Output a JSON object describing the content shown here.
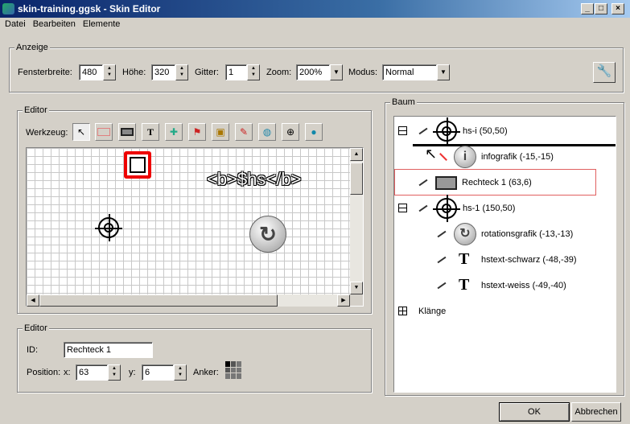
{
  "window": {
    "title": "skin-training.ggsk - Skin Editor",
    "controls": [
      "_",
      "□",
      "×"
    ]
  },
  "menu": [
    "Datei",
    "Bearbeiten",
    "Elemente"
  ],
  "anzeige": {
    "legend": "Anzeige",
    "fensterbreite_label": "Fensterbreite:",
    "fensterbreite": "480",
    "hoehe_label": "Höhe:",
    "hoehe": "320",
    "gitter_label": "Gitter:",
    "gitter": "1",
    "zoom_label": "Zoom:",
    "zoom": "200%",
    "modus_label": "Modus:",
    "modus": "Normal"
  },
  "editor": {
    "legend": "Editor",
    "werkzeug_label": "Werkzeug:",
    "tools": [
      "select-tool",
      "rectangle-outline-tool",
      "rectangle-filled-tool",
      "text-tool",
      "image-tool",
      "hotspot-image-tool",
      "button-tool",
      "rotation-tool",
      "globe-tool",
      "crosshair-tool",
      "pin-tool"
    ],
    "canvas_text": "<b>$hs</b>"
  },
  "props": {
    "legend": "Editor",
    "id_label": "ID:",
    "id": "Rechteck 1",
    "position_label": "Position:",
    "x_label": "x:",
    "x": "63",
    "y_label": "y:",
    "y": "6",
    "anker_label": "Anker:"
  },
  "tree": {
    "legend": "Baum",
    "items": [
      {
        "label": "hs-i (50,50)",
        "icon": "hotspot-icon"
      },
      {
        "label": "infografik (-15,-15)",
        "icon": "info-icon"
      },
      {
        "label": "Rechteck 1 (63,6)",
        "icon": "rectangle-icon",
        "selected": true
      },
      {
        "label": "hs-1 (150,50)",
        "icon": "hotspot-icon"
      },
      {
        "label": "rotationsgrafik (-13,-13)",
        "icon": "rotation-icon"
      },
      {
        "label": "hstext-schwarz (-48,-39)",
        "icon": "text-icon"
      },
      {
        "label": "hstext-weiss (-49,-40)",
        "icon": "text-icon"
      },
      {
        "label": "Klänge",
        "icon": "expand-icon"
      }
    ]
  },
  "buttons": {
    "ok": "OK",
    "cancel": "Abbrechen"
  }
}
